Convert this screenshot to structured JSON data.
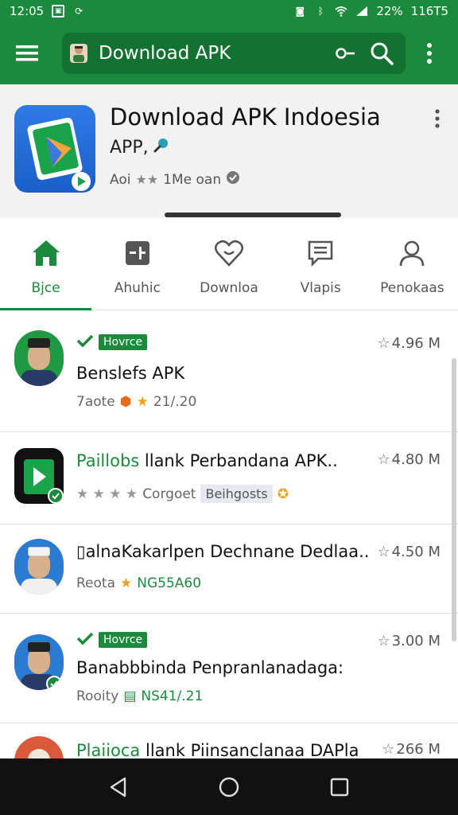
{
  "status_bar": {
    "time": "12:05",
    "left_icons": [
      "photo-icon",
      "sync-icon"
    ],
    "battery": "22%",
    "right_text": "116T5"
  },
  "app_bar": {
    "search_text": "Download APK"
  },
  "app_header": {
    "title": "Download APK Indoesia",
    "subtitle": "APP,",
    "meta_prefix": "Aoi",
    "meta_text": "1Me oan"
  },
  "tabs": [
    {
      "label": "Bjce",
      "icon": "home-icon"
    },
    {
      "label": "Ahuhic",
      "icon": "editor-icon"
    },
    {
      "label": "Downloa",
      "icon": "heart-icon"
    },
    {
      "label": "Vlapis",
      "icon": "message-icon"
    },
    {
      "label": "Penokaas",
      "icon": "person-icon"
    }
  ],
  "list": [
    {
      "badge": "Hovrce",
      "title": "Benslefs APK",
      "meta_label": "7aote",
      "meta_value": "21/.20",
      "size": "4.96 M"
    },
    {
      "title_green": "Paillobs",
      "title": " llank Perbandana APK..",
      "meta_label": "Corgoet",
      "meta_tag": "Beihgosts",
      "size": "4.80 M"
    },
    {
      "title": "alnaKakarlpen Dechnane Dedlaa...",
      "meta_label": "Reota",
      "meta_value": "NG55A60",
      "size": "4.50 M"
    },
    {
      "badge": "Hovrce",
      "title": "Banabbbinda Penpranlanadaga:",
      "meta_label": "Rooity",
      "meta_value": "NS41/.21",
      "size": "3.00 M"
    },
    {
      "title_green": "Plaiioca",
      "title": " llank Piinsanclanaa DAPla",
      "size": "266 M"
    }
  ],
  "colors": {
    "brand_green": "#1c8a3c",
    "dark_green": "#137131",
    "star_orange": "#f0a020"
  }
}
